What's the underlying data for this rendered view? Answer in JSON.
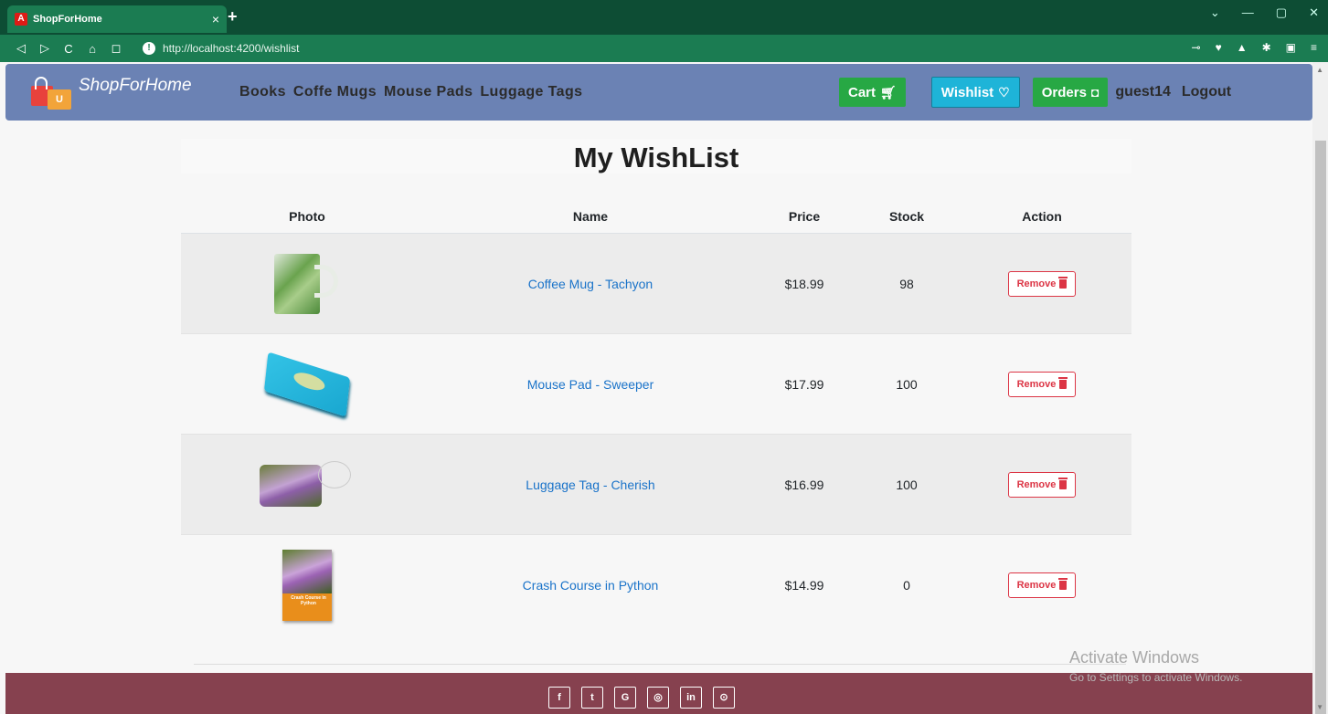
{
  "browser": {
    "tab_title": "ShopForHome",
    "tab_favicon": "A",
    "tab_close": "×",
    "new_tab": "+",
    "url": "http://localhost:4200/wishlist",
    "nav_buttons": [
      "◁",
      "▷",
      "C",
      "⌂",
      "◻"
    ]
  },
  "app": {
    "brand": "ShopForHome",
    "brand_bag_letter": "U",
    "nav_links": [
      "Books",
      "Coffe Mugs",
      "Mouse Pads",
      "Luggage Tags"
    ],
    "cart_label": "Cart",
    "wishlist_label": "Wishlist",
    "orders_label": "Orders",
    "username": "guest14",
    "logout_label": "Logout",
    "accent_nav": "#6b82b4",
    "cart_color": "#27a844",
    "wishlist_color": "#1eb4d8"
  },
  "page": {
    "title": "My WishList",
    "columns": [
      "Photo",
      "Name",
      "Price",
      "Stock",
      "Action"
    ],
    "rows": [
      {
        "name": "Coffee Mug - Tachyon",
        "price": "$18.99",
        "stock": "98",
        "action": "Remove",
        "image": "mug-image"
      },
      {
        "name": "Mouse Pad - Sweeper",
        "price": "$17.99",
        "stock": "100",
        "action": "Remove",
        "image": "mousepad-image"
      },
      {
        "name": "Luggage Tag - Cherish",
        "price": "$16.99",
        "stock": "100",
        "action": "Remove",
        "image": "luggage-tag-image"
      },
      {
        "name": "Crash Course in Python",
        "price": "$14.99",
        "stock": "0",
        "action": "Remove",
        "image": "book-image"
      }
    ],
    "book_cover_text": "Crash Course in Python"
  },
  "footer": {
    "social": [
      "f",
      "t",
      "G",
      "◎",
      "in",
      "⊙"
    ],
    "footer_color": "#86414f"
  },
  "watermark": {
    "line1": "Activate Windows",
    "line2": "Go to Settings to activate Windows."
  }
}
